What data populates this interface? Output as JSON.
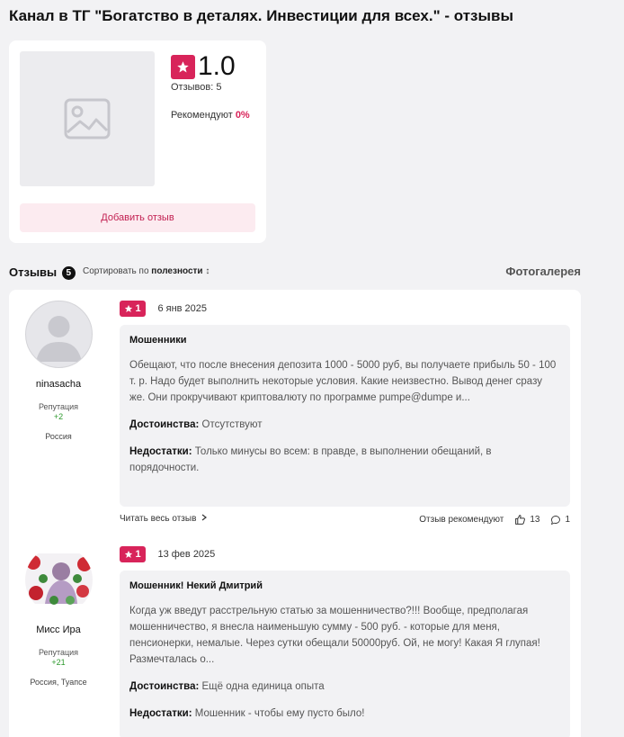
{
  "page": {
    "title": "Канал в ТГ \"Богатство в деталях. Инвестиции для всех.\" - отзывы"
  },
  "summary": {
    "rating": "1.0",
    "reviews_label": "Отзывов: 5",
    "recommend_label": "Рекомендуют",
    "recommend_value": "0%",
    "add_review_label": "Добавить отзыв"
  },
  "reviews_bar": {
    "heading": "Отзывы",
    "count": "5",
    "sort_prefix": "Сортировать по",
    "sort_value": "полезности",
    "sort_arrow": "↕",
    "gallery": "Фотогалерея"
  },
  "reviews": [
    {
      "author": "ninasacha",
      "reputation_label": "Репутация",
      "reputation": "+2",
      "location": "Россия",
      "rating": "1",
      "date": "6 янв 2025",
      "title": "Мошенники",
      "text": "Обещают, что после внесения депозита 1000 - 5000 руб, вы получаете прибыль 50 - 100 т. р. Надо будет выполнить некоторые условия. Какие неизвестно. Вывод денег сразу же. Они прокручивают криптовалюту по программе pumpe@dumpe и...",
      "pros_label": "Достоинства:",
      "pros": "Отсутствуют",
      "cons_label": "Недостатки:",
      "cons": "Только минусы во всем: в правде, в выполнении обещаний, в порядочности.",
      "read_more": "Читать весь отзыв",
      "recommended_label": "Отзыв рекомендуют",
      "likes": "13",
      "comments": "1"
    },
    {
      "author": "Мисс Ира",
      "reputation_label": "Репутация",
      "reputation": "+21",
      "location": "Россия, Туапсе",
      "rating": "1",
      "date": "13 фев 2025",
      "title": "Мошенник! Некий Дмитрий",
      "text": "Когда уж введут расстрельную статью за мошенничество?!!! Вообще, предполагая мошенничество, я внесла наименьшую сумму - 500 руб. - которые для меня, пенсионерки, немалые. Через сутки обещали 50000руб. Ой, не могу! Какая Я глупая! Размечталась о...",
      "pros_label": "Достоинства:",
      "pros": "Ещё одна единица опыта",
      "cons_label": "Недостатки:",
      "cons": "Мошенник - чтобы ему пусто было!"
    }
  ],
  "colors": {
    "accent": "#d8245a",
    "accent_light": "#fcebf0",
    "positive": "#2e9a2e",
    "background": "#f2f2f4"
  }
}
